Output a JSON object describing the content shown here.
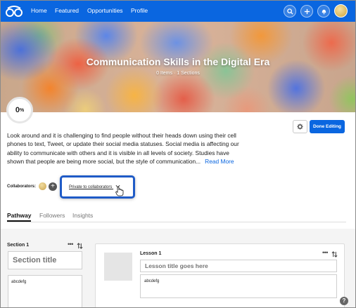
{
  "nav": {
    "links": [
      "Home",
      "Featured",
      "Opportunities",
      "Profile"
    ],
    "icons": [
      "search-icon",
      "plus-icon",
      "bell-icon"
    ],
    "accent": "#0a66e0"
  },
  "hero": {
    "title": "Communication Skills in the Digital Era",
    "subtitle": "0 Items · 1 Sections"
  },
  "progress": {
    "value": "0",
    "unit": "%"
  },
  "actions": {
    "done_label": "Done Editing"
  },
  "description": {
    "text": "Look around and it is challenging to find people without their heads down using their cell phones to text, Tweet, or update their social media statuses. Social media is affecting our ability to communicate with others and it is visible in all levels of society. Studies have shown that people are being more social, but the style of communication...",
    "read_more": "Read More"
  },
  "collaborators": {
    "label": "Collaborators:",
    "add_label": "+",
    "privacy": "Private to collaborators"
  },
  "tabs": [
    "Pathway",
    "Followers",
    "Insights"
  ],
  "section": {
    "label": "Section 1",
    "title_placeholder": "Section title",
    "description": "abcdefg"
  },
  "lesson": {
    "label": "Lesson 1",
    "title_placeholder": "Lesson title goes here",
    "description": "abcdefg"
  },
  "help": "?"
}
